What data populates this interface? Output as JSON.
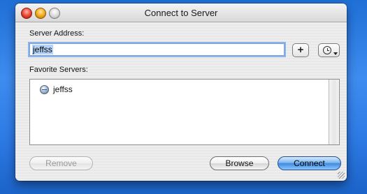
{
  "window": {
    "title": "Connect to Server"
  },
  "server_address": {
    "label": "Server Address:",
    "value": "jeffss"
  },
  "buttons": {
    "add_label": "+",
    "remove_label": "Remove",
    "browse_label": "Browse",
    "connect_label": "Connect"
  },
  "favorites": {
    "label": "Favorite Servers:",
    "items": [
      {
        "label": "jeffss",
        "icon": "globe-icon"
      }
    ]
  },
  "icons": {
    "add": "plus-icon",
    "recent": "clock-icon",
    "server": "globe-icon"
  },
  "colors": {
    "desktop": "#2e7be6",
    "connect_button": "#3f8be0",
    "selection": "#b5d3f8"
  }
}
